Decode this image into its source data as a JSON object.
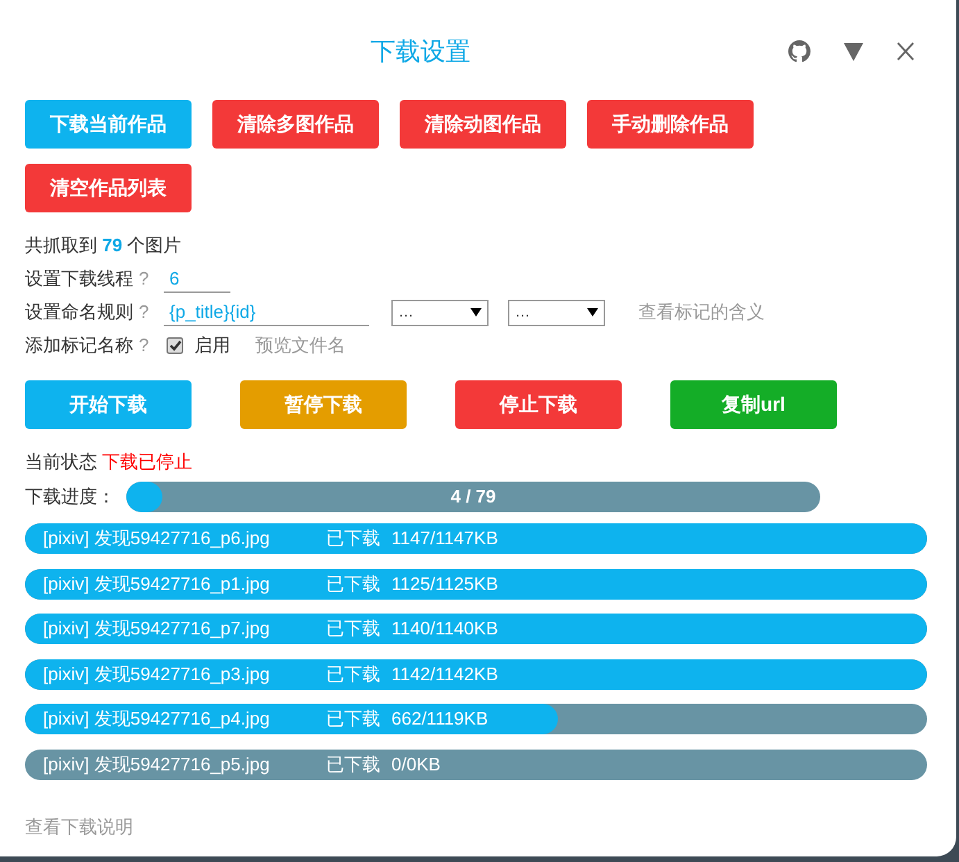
{
  "window": {
    "title": "下载设置"
  },
  "top_buttons": [
    {
      "label": "下载当前作品",
      "color": "#0eb3ee"
    },
    {
      "label": "清除多图作品",
      "color": "#f33939"
    },
    {
      "label": "清除动图作品",
      "color": "#f33939"
    },
    {
      "label": "手动删除作品",
      "color": "#f33939"
    },
    {
      "label": "清空作品列表",
      "color": "#f33939"
    }
  ],
  "summary": {
    "prefix": "共抓取到",
    "count": "79",
    "suffix": "个图片"
  },
  "thread_setting": {
    "label": "设置下载线程",
    "help": "?",
    "value": "6"
  },
  "naming_setting": {
    "label": "设置命名规则",
    "help": "?",
    "value": "{p_title}{id}",
    "select_1": "…",
    "select_2": "…",
    "link": "查看标记的含义"
  },
  "tag_setting": {
    "label": "添加标记名称",
    "help": "?",
    "checked": true,
    "checkbox_label": "启用",
    "link": "预览文件名"
  },
  "action_buttons": [
    {
      "label": "开始下载",
      "color": "#0eb3ee"
    },
    {
      "label": "暂停下载",
      "color": "#e49d00"
    },
    {
      "label": "停止下载",
      "color": "#f33939"
    },
    {
      "label": "复制url",
      "color": "#14ad27"
    }
  ],
  "status": {
    "label": "当前状态",
    "value": "下载已停止"
  },
  "progress": {
    "label": "下载进度：",
    "level": 0.05,
    "reading": "4 / 79"
  },
  "files": [
    {
      "name": "[pixiv] 发现59427716_p6.jpg",
      "state": "已下载",
      "size": "1147/1147KB",
      "level": 1
    },
    {
      "name": "[pixiv] 发现59427716_p1.jpg",
      "state": "已下载",
      "size": "1125/1125KB",
      "level": 1
    },
    {
      "name": "[pixiv] 发现59427716_p7.jpg",
      "state": "已下载",
      "size": "1140/1140KB",
      "level": 1
    },
    {
      "name": "[pixiv] 发现59427716_p3.jpg",
      "state": "已下载",
      "size": "1142/1142KB",
      "level": 1
    },
    {
      "name": "[pixiv] 发现59427716_p4.jpg",
      "state": "已下载",
      "size": "662/1119KB",
      "level": 0.59
    },
    {
      "name": "[pixiv] 发现59427716_p5.jpg",
      "state": "已下载",
      "size": "0/0KB",
      "level": 0
    }
  ],
  "help_link": "查看下载说明"
}
